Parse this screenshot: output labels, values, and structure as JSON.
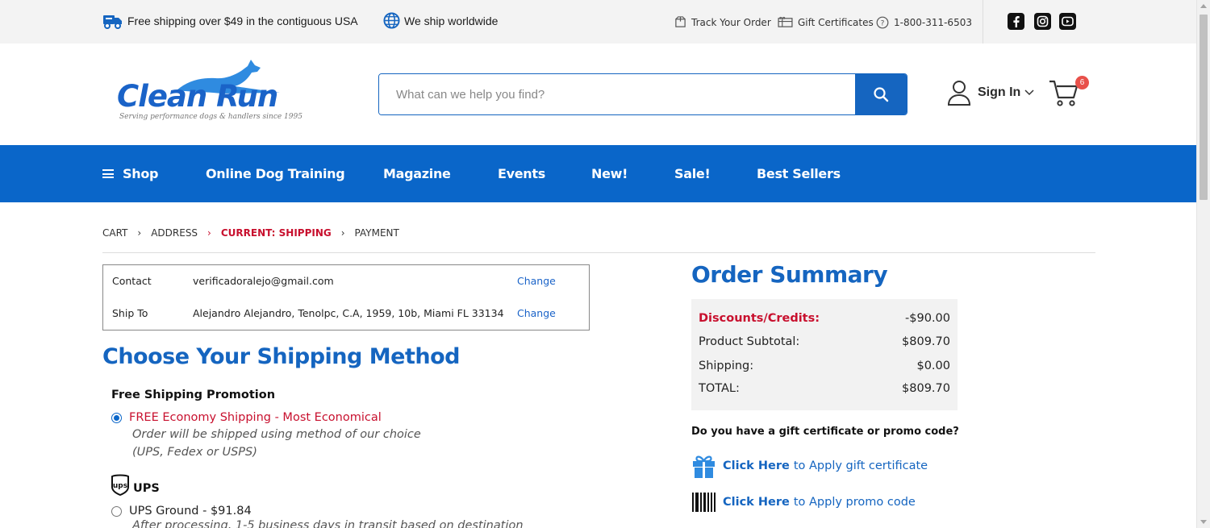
{
  "colors": {
    "brand_blue": "#0a66c9",
    "accent_red": "#c8102e",
    "badge_red": "#e8504a"
  },
  "topbar": {
    "free_shipping": "Free shipping over $49 in the contiguous USA",
    "worldwide": "We ship worldwide",
    "track_order": "Track Your Order",
    "gift_certificates": "Gift Certificates",
    "phone": "1-800-311-6503",
    "social_icons": [
      "facebook-icon",
      "instagram-icon",
      "youtube-icon"
    ]
  },
  "header": {
    "logo_text": "Clean Run",
    "tagline": "Serving performance dogs & handlers since 1995",
    "search_placeholder": "What can we help you find?",
    "sign_in": "Sign In",
    "cart_count": "6"
  },
  "nav": {
    "items": [
      "Shop",
      "Online Dog Training",
      "Magazine",
      "Events",
      "New!",
      "Sale!",
      "Best Sellers"
    ]
  },
  "breadcrumb": {
    "steps": [
      "CART",
      "ADDRESS",
      "CURRENT: SHIPPING",
      "PAYMENT"
    ],
    "current_index": 2
  },
  "contact_box": {
    "contact_label": "Contact",
    "contact_value": "verificadoralejo@gmail.com",
    "ship_label": "Ship To",
    "ship_value": "Alejandro Alejandro, Tenolpc, C.A, 1959, 10b, Miami FL 33134",
    "change_label": "Change"
  },
  "shipping": {
    "heading": "Choose Your Shipping Method",
    "free_group": "Free Shipping Promotion",
    "free_option": "FREE Economy Shipping - Most Economical",
    "free_selected": true,
    "free_note_1": "Order will be shipped using method of our choice",
    "free_note_2": "(UPS, Fedex or USPS)",
    "ups_group": "UPS",
    "ups_option": "UPS Ground - $91.84",
    "ups_note": "After processing, 1-5 business days in transit based on destination"
  },
  "summary": {
    "heading": "Order Summary",
    "discounts_label": "Discounts/Credits:",
    "discounts_value": "-$90.00",
    "subtotal_label": "Product Subtotal:",
    "subtotal_value": "$809.70",
    "shipping_label": "Shipping:",
    "shipping_value": "$0.00",
    "total_label": "TOTAL:",
    "total_value": "$809.70",
    "promo_question": "Do you have a gift certificate or promo code?",
    "click_here": "Click Here",
    "gift_link_rest": "to Apply gift certificate",
    "promo_link_rest": "to Apply promo code"
  }
}
